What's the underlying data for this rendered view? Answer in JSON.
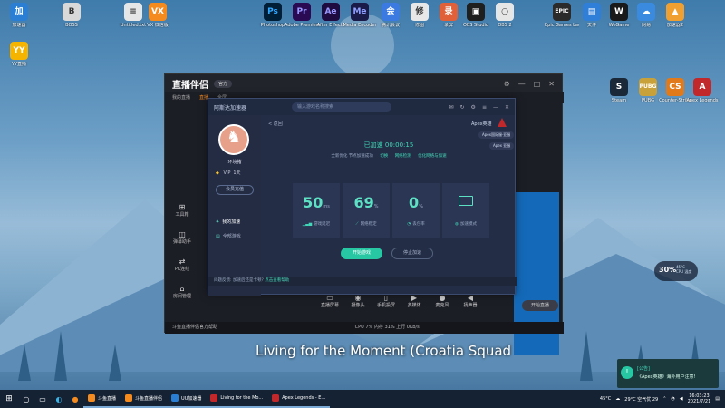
{
  "desktop": {
    "icons": [
      {
        "label": "加速器",
        "color": "#2a7fd4",
        "glyph": "加"
      },
      {
        "label": "YY直播",
        "color": "#f5b400",
        "glyph": "YY"
      },
      {
        "label": "BOSS",
        "color": "#d9d9d9",
        "glyph": "B"
      },
      {
        "label": "Untitled.txt",
        "color": "#e6e6e6",
        "glyph": "≡"
      },
      {
        "label": "VX 微信版",
        "color": "#f58a1f",
        "glyph": "VX"
      },
      {
        "label": "Photoshop",
        "color": "#001e36",
        "glyph": "Ps"
      },
      {
        "label": "Adobe Premiere",
        "color": "#2a0a52",
        "glyph": "Pr"
      },
      {
        "label": "After Effects",
        "color": "#1f0b40",
        "glyph": "Ae"
      },
      {
        "label": "Media Encoder",
        "color": "#1b1b4a",
        "glyph": "Me"
      },
      {
        "label": "腾讯会议",
        "color": "#3b7ae0",
        "glyph": "会"
      },
      {
        "label": "修图",
        "color": "#e8e8e8",
        "glyph": "修"
      },
      {
        "label": "录屏",
        "color": "#e0603a",
        "glyph": "录"
      },
      {
        "label": "OBS Studio",
        "color": "#1f1f1f",
        "glyph": "▣"
      },
      {
        "label": "OBS 2",
        "color": "#e6e6e6",
        "glyph": "○"
      },
      {
        "label": "Epic Games Launcher",
        "color": "#2b2b2b",
        "glyph": "EPIC"
      },
      {
        "label": "文件",
        "color": "#2f7ed8",
        "glyph": "▤"
      },
      {
        "label": "WeGame",
        "color": "#1a1a1a",
        "glyph": "W"
      },
      {
        "label": "网易",
        "color": "#3a8be0",
        "glyph": "☁"
      },
      {
        "label": "加速器2",
        "color": "#f0a030",
        "glyph": "▲"
      },
      {
        "label": "Steam",
        "color": "#1b2838",
        "glyph": "S"
      },
      {
        "label": "PUBG",
        "color": "#c9a13a",
        "glyph": "PUBG"
      },
      {
        "label": "Counter-Strike",
        "color": "#e07a1a",
        "glyph": "CS"
      },
      {
        "label": "Apex Legends",
        "color": "#c0282c",
        "glyph": "A"
      }
    ]
  },
  "app": {
    "title": "直播伴侣",
    "version_badge": "官方",
    "tabs": [
      "我的直播",
      "直播",
      "全屏"
    ],
    "tools": [
      {
        "label": "工具箱",
        "glyph": "⊞"
      },
      {
        "label": "弹幕助手",
        "glyph": "◫"
      },
      {
        "label": "PK连线",
        "glyph": "⇄"
      },
      {
        "label": "房间管理",
        "glyph": "⌂"
      }
    ],
    "bottom_buttons": [
      {
        "label": "直播屏幕",
        "glyph": "▭"
      },
      {
        "label": "摄像头",
        "glyph": "◉"
      },
      {
        "label": "手机投屏",
        "glyph": "▯"
      },
      {
        "label": "多媒体",
        "glyph": "▶"
      },
      {
        "label": "麦克风",
        "glyph": "●"
      },
      {
        "label": "扬声器",
        "glyph": "◀"
      }
    ],
    "start_live": "开始直播",
    "status_text": "斗鱼直播伴侣官方帮助",
    "status_metrics": "CPU 7%   内存 31%   上行 0Kb/s"
  },
  "accelerator": {
    "title": "阿斯达加速器",
    "search_placeholder": "输入游戏名称搜索",
    "user": {
      "name": "环境猪",
      "vip_label": "VIP",
      "vip_days": "1天",
      "member_button": "会员充值"
    },
    "nav": [
      {
        "label": "我的加速",
        "active": true,
        "glyph": "✈"
      },
      {
        "label": "全部游戏",
        "active": false,
        "glyph": "▤"
      }
    ],
    "back_label": "< 返回",
    "game_name": "Apex英雄",
    "tags": [
      "Apex国际服·亚服",
      "Apex 亚服"
    ],
    "status": "已加速 00:00:15",
    "info_line": "全新优化 节点加速成功",
    "info_links": [
      "切换",
      "网络检测",
      "优化网络与加速"
    ],
    "metrics": [
      {
        "value": "50",
        "unit": "ms",
        "label": "游戏延迟",
        "glyph": "▁▃▅"
      },
      {
        "value": "69",
        "unit": "%",
        "label": "网络稳定",
        "glyph": "⟋"
      },
      {
        "value": "0",
        "unit": "%",
        "label": "丢包率",
        "glyph": "◔"
      },
      {
        "value": "",
        "unit": "",
        "label": "加速模式",
        "glyph": "◍"
      }
    ],
    "btn_start": "开始游戏",
    "btn_stop": "停止加速",
    "footer_link": "设置加速模式",
    "footer_text": "问题反馈: 加速后还是卡顿?",
    "footer_hl": "点击查看帮助"
  },
  "lyric": "Living for the Moment (Croatia Squad",
  "cpu_widget": {
    "percent": "30%",
    "temp": "45°C",
    "label": "CPU 温度"
  },
  "notification": {
    "title": "[公告]",
    "body": "《Apex英雄》海外用户注意!"
  },
  "taskbar": {
    "apps": [
      {
        "label": "斗鱼直播",
        "color": "#f58a1f"
      },
      {
        "label": "斗鱼直播伴侣",
        "color": "#f58a1f"
      },
      {
        "label": "UU加速器",
        "color": "#2a7fd4"
      },
      {
        "label": "Living for the Mo...",
        "color": "#c0282c"
      },
      {
        "label": "Apex Legends - E...",
        "color": "#c0282c"
      }
    ],
    "temp": "45°C",
    "weather": "29°C  空气优 29",
    "time": "16:03:23",
    "date": "2021/7/21"
  }
}
